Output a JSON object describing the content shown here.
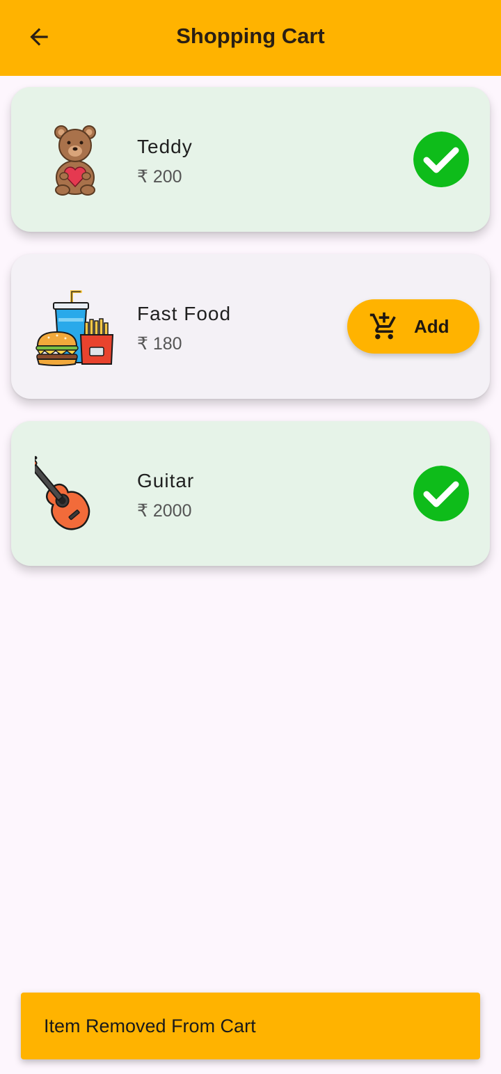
{
  "app_bar": {
    "title": "Shopping Cart",
    "back_icon": "arrow-back-icon",
    "background_color": "#ffb300"
  },
  "products": [
    {
      "name": "Teddy",
      "price": "₹ 200",
      "icon": "teddy-bear-icon",
      "in_cart": true,
      "card_color": "#e6f3e8"
    },
    {
      "name": "Fast Food",
      "price": "₹ 180",
      "icon": "fast-food-icon",
      "in_cart": false,
      "card_color": "#f4f1f6",
      "add_label": "Add"
    },
    {
      "name": "Guitar",
      "price": "₹ 2000",
      "icon": "guitar-icon",
      "in_cart": true,
      "card_color": "#e6f3e8"
    }
  ],
  "snackbar": {
    "message": "Item Removed From Cart",
    "background_color": "#ffb300"
  },
  "colors": {
    "accent": "#ffb300",
    "check_green": "#0ebc1a",
    "page_background": "#fdf6fd"
  }
}
